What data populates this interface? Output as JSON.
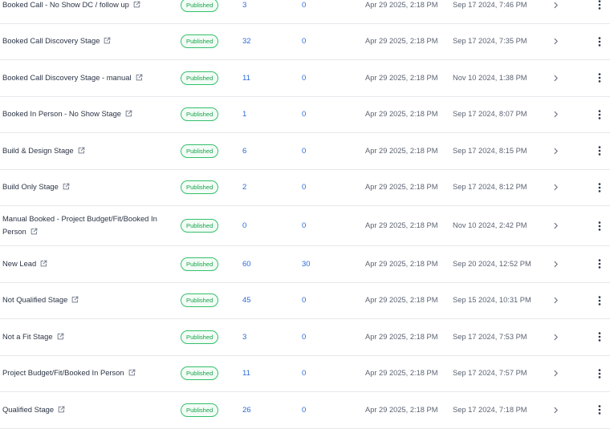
{
  "table": {
    "rows": [
      {
        "name": "Booked Call - No Show DC / follow up",
        "status": "Published",
        "count_a": "3",
        "count_b": "0",
        "updated": "Apr 29 2025, 2:18 PM",
        "created": "Sep 17 2024, 7:46 PM"
      },
      {
        "name": "Booked Call Discovery Stage",
        "status": "Published",
        "count_a": "32",
        "count_b": "0",
        "updated": "Apr 29 2025, 2:18 PM",
        "created": "Sep 17 2024, 7:35 PM"
      },
      {
        "name": "Booked Call Discovery Stage - manual",
        "status": "Published",
        "count_a": "11",
        "count_b": "0",
        "updated": "Apr 29 2025, 2:18 PM",
        "created": "Nov 10 2024, 1:38 PM"
      },
      {
        "name": "Booked In Person - No Show Stage",
        "status": "Published",
        "count_a": "1",
        "count_b": "0",
        "updated": "Apr 29 2025, 2:18 PM",
        "created": "Sep 17 2024, 8:07 PM"
      },
      {
        "name": "Build & Design Stage",
        "status": "Published",
        "count_a": "6",
        "count_b": "0",
        "updated": "Apr 29 2025, 2:18 PM",
        "created": "Sep 17 2024, 8:15 PM"
      },
      {
        "name": "Build Only Stage",
        "status": "Published",
        "count_a": "2",
        "count_b": "0",
        "updated": "Apr 29 2025, 2:18 PM",
        "created": "Sep 17 2024, 8:12 PM"
      },
      {
        "name": "Manual Booked - Project Budget/Fit/Booked In Person",
        "status": "Published",
        "count_a": "0",
        "count_b": "0",
        "updated": "Apr 29 2025, 2:18 PM",
        "created": "Nov 10 2024, 2:42 PM"
      },
      {
        "name": "New Lead",
        "status": "Published",
        "count_a": "60",
        "count_b": "30",
        "updated": "Apr 29 2025, 2:18 PM",
        "created": "Sep 20 2024, 12:52 PM"
      },
      {
        "name": "Not Qualified Stage",
        "status": "Published",
        "count_a": "45",
        "count_b": "0",
        "updated": "Apr 29 2025, 2:18 PM",
        "created": "Sep 15 2024, 10:31 PM"
      },
      {
        "name": "Not a Fit Stage",
        "status": "Published",
        "count_a": "3",
        "count_b": "0",
        "updated": "Apr 29 2025, 2:18 PM",
        "created": "Sep 17 2024, 7:53 PM"
      },
      {
        "name": "Project Budget/Fit/Booked In Person",
        "status": "Published",
        "count_a": "11",
        "count_b": "0",
        "updated": "Apr 29 2025, 2:18 PM",
        "created": "Sep 17 2024, 7:57 PM"
      },
      {
        "name": "Qualified Stage",
        "status": "Published",
        "count_a": "26",
        "count_b": "0",
        "updated": "Apr 29 2025, 2:18 PM",
        "created": "Sep 17 2024, 7:18 PM"
      }
    ]
  },
  "icons": {
    "external": "external-link-icon",
    "chevron": "chevron-right-icon",
    "more": "more-vertical-icon"
  },
  "colors": {
    "published_text": "#16a34a",
    "published_border": "#34c06b",
    "count_link": "#2c6ad8",
    "divider": "#e6e8ec"
  }
}
